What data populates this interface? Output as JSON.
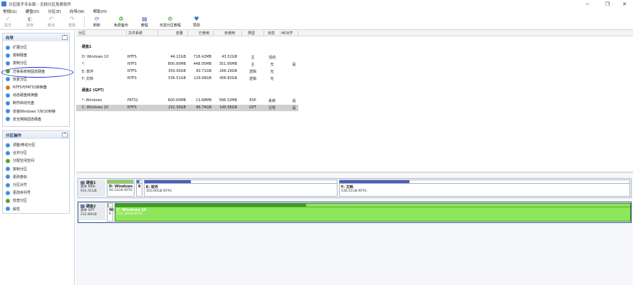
{
  "titlebar": {
    "title": "分区助手专业版 - 无损分区免费软件",
    "minimize": "−",
    "maximize": "❐",
    "close": "✕"
  },
  "menu": [
    "常规(G)",
    "硬盘(D)",
    "分区(E)",
    "向导(W)",
    "帮助(H)"
  ],
  "toolbar": {
    "buttons": [
      {
        "label": "提交",
        "icon": "check-icon",
        "enabled": false
      },
      {
        "label": "放弃",
        "icon": "discard-icon",
        "enabled": false
      },
      {
        "label": "撤消",
        "icon": "undo-icon",
        "enabled": false
      },
      {
        "label": "重做",
        "icon": "redo-icon",
        "enabled": false
      },
      {
        "label": "刷新",
        "icon": "refresh-icon",
        "enabled": true
      },
      {
        "label": "免费备份",
        "icon": "backup-icon",
        "enabled": true
      },
      {
        "label": "教程",
        "icon": "tutorial-icon",
        "enabled": true
      },
      {
        "label": "无损分区教程",
        "icon": "partition-tutorial-icon",
        "enabled": true
      },
      {
        "label": "赞助",
        "icon": "heart-icon",
        "enabled": true
      }
    ]
  },
  "sidebar": {
    "wizard": {
      "title": "向导",
      "collapse": "^",
      "items": [
        {
          "label": "扩展分区",
          "icon": "extend-icon",
          "color": "#3f8edc"
        },
        {
          "label": "复制硬盘",
          "icon": "copy-disk-icon",
          "color": "#3f8edc"
        },
        {
          "label": "复制分区",
          "icon": "copy-partition-icon",
          "color": "#3f8edc"
        },
        {
          "label": "迁移系统到固态硬盘",
          "icon": "migrate-os-icon",
          "color": "#5aa02c"
        },
        {
          "label": "恢复分区",
          "icon": "recover-icon",
          "color": "#3f8edc"
        },
        {
          "label": "NTFS与FAT32转换器",
          "icon": "convert-icon",
          "color": "#d07a2a"
        },
        {
          "label": "动态硬盘转换器",
          "icon": "dynamic-disk-icon",
          "color": "#3f8edc"
        },
        {
          "label": "制作启动光盘",
          "icon": "bootable-disc-icon",
          "color": "#3f8edc"
        },
        {
          "label": "安装Windows 7/8/10到移",
          "icon": "windows-to-go-icon",
          "color": "#3f8edc"
        },
        {
          "label": "安全擦除固态硬盘",
          "icon": "ssd-erase-icon",
          "color": "#3f8edc"
        }
      ]
    },
    "operations": {
      "title": "分区操作",
      "collapse": "^",
      "items": [
        {
          "label": "调整/移动分区",
          "icon": "resize-icon",
          "color": "#3f8edc"
        },
        {
          "label": "合并分区",
          "icon": "merge-icon",
          "color": "#3f8edc"
        },
        {
          "label": "分配空闲空间",
          "icon": "allocate-icon",
          "color": "#5aa02c"
        },
        {
          "label": "复制分区",
          "icon": "copy-partition-icon",
          "color": "#3f8edc"
        },
        {
          "label": "更改卷标",
          "icon": "label-icon",
          "color": "#3f8edc"
        },
        {
          "label": "分区对齐",
          "icon": "align-icon",
          "color": "#3f8edc"
        },
        {
          "label": "更改序列号",
          "icon": "serial-icon",
          "color": "#3f8edc"
        },
        {
          "label": "检查分区",
          "icon": "check-partition-icon",
          "color": "#5aa02c"
        },
        {
          "label": "属性",
          "icon": "properties-icon",
          "color": "#3f8edc"
        }
      ]
    }
  },
  "table": {
    "columns": [
      "分区",
      "文件系统",
      "容量",
      "已使用",
      "未使用",
      "类型",
      "状态",
      "4K对齐"
    ],
    "disks": [
      {
        "heading": "硬盘1",
        "rows": [
          {
            "partition": "D: Windows 10",
            "fs": "NTFS",
            "capacity": "44.22GB",
            "used": "718.42MB",
            "unused": "43.52GB",
            "type": "主",
            "status": "活动",
            "align": ""
          },
          {
            "partition": "*:",
            "fs": "NTFS",
            "capacity": "800.00MB",
            "used": "448.05MB",
            "unused": "351.95MB",
            "type": "主",
            "status": "无",
            "align": "是"
          },
          {
            "partition": "E: 软件",
            "fs": "NTFS",
            "capacity": "350.00GB",
            "used": "83.71GB",
            "unused": "266.29GB",
            "type": "逻辑",
            "status": "无",
            "align": ""
          },
          {
            "partition": "F: 文档",
            "fs": "NTFS",
            "capacity": "536.51GB",
            "used": "129.68GB",
            "unused": "406.83GB",
            "type": "逻辑",
            "status": "无",
            "align": ""
          }
        ]
      },
      {
        "heading": "硬盘2 (GPT)",
        "rows": [
          {
            "partition": "*: Windows",
            "fs": "FAT32",
            "capacity": "600.00MB",
            "used": "13.68MB",
            "unused": "586.32MB",
            "type": "ESP",
            "status": "系统",
            "align": "是"
          },
          {
            "partition": "C: Windows 10",
            "fs": "NTFS",
            "capacity": "232.30GB",
            "used": "86.74GB",
            "unused": "145.56GB",
            "type": "GPT",
            "status": "引导",
            "align": "是"
          }
        ]
      }
    ]
  },
  "diskmap": [
    {
      "title": "硬盘1",
      "line1": "基本 MBR",
      "line2": "931.51GB",
      "partitions": [
        {
          "name": "D: Windows",
          "size": "44.22GB NTFS",
          "fill": 0.98,
          "color": "#8ed05a"
        },
        {
          "name": "8",
          "size": "",
          "fill": 0.5,
          "color": "#5b6fc8"
        },
        {
          "name": "E: 软件",
          "size": "350.00GB NTFS",
          "fill": 0.24,
          "color": "#4e5fb8"
        },
        {
          "name": "F: 文档",
          "size": "536.51GB NTFS",
          "fill": 0.24,
          "color": "#4e5fb8"
        }
      ]
    },
    {
      "title": "硬盘2",
      "line1": "基本 GPT",
      "line2": "232.89GB",
      "partitions": [
        {
          "name": "W:",
          "size": "6.",
          "fill": 0.3,
          "color": "#8ed05a"
        },
        {
          "name": "C: Windows 10",
          "size": "232.30GB NTFS",
          "fill": 0.37,
          "color": "#3c9a26"
        }
      ]
    }
  ]
}
